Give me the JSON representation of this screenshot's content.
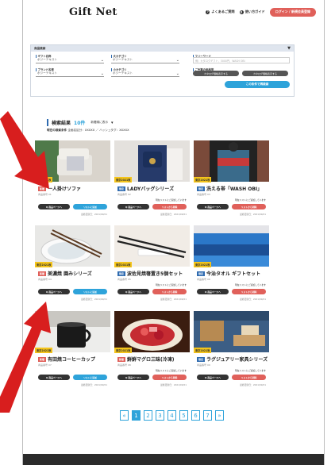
{
  "header": {
    "logo": "Gift Net",
    "faq": "よくあるご質問",
    "guide": "使い方ガイド",
    "login": "ログイン / 新規会員登録"
  },
  "search": {
    "panel_title": "商品検索",
    "giftname_label": "ギフト名称",
    "giftname_value": "ポジーテキスト",
    "maincat_label": "大カテゴリ",
    "maincat_value": "ポジーテキスト",
    "keyword_label": "フリーワード",
    "keyword_placeholder": "例）カタログギフト、3000円、WASH OBI",
    "brand_label": "ブランド名称",
    "brand_value": "ポジーテキスト",
    "subcat_label": "小カテゴリ",
    "subcat_value": "ポジーテキスト",
    "price_label": "ご予算の価格帯",
    "price_min_btn": "カタログ価格表示する",
    "price_max_btn": "カタログ価格表示する",
    "search_btn": "この条件で再検索"
  },
  "results": {
    "title": "検索結果",
    "count": "10件",
    "sort": "新着順に表示",
    "sub_label": "現在の検索条件",
    "sub_value": "企画名区分：XXXXX ／ ハッシュタグ：XXXXX"
  },
  "cards": [
    {
      "badge": "東京2021秋",
      "tag": "新着",
      "tag_color": "#e0605a",
      "title": "一人掛けソファ",
      "meta": "商品番号 01",
      "note": "",
      "btn1": "Q 商品ページへ",
      "btn2": "リストに追加",
      "btn2_color": "blue",
      "date": "最終更新日：2021/09/21"
    },
    {
      "badge": "東京2021秋",
      "tag": "限定",
      "tag_color": "#2f6bb0",
      "title": "LADYバッグシリーズ",
      "meta": "商品番号 02",
      "note": "現在リストにご追加しています",
      "btn1": "Q 商品ページへ",
      "btn2": "リストから削除",
      "btn2_color": "red",
      "date": "最終更新日：2021/09/21"
    },
    {
      "badge": "東京2021秋",
      "tag": "限定",
      "tag_color": "#2f6bb0",
      "title": "洗える帯「WASH OBI」",
      "meta": "商品番号 03",
      "note": "現在リストにご追加しています",
      "btn1": "Q 商品ページへ",
      "btn2": "リストから削除",
      "btn2_color": "red",
      "date": "最終更新日：2021/09/21"
    },
    {
      "badge": "東京2021秋",
      "tag": "新着",
      "tag_color": "#e0605a",
      "title": "美濃焼 園みシリーズ",
      "meta": "商品番号 04",
      "note": "",
      "btn1": "Q 商品ページへ",
      "btn2": "リストに追加",
      "btn2_color": "blue",
      "date": "最終更新日：2021/09/21"
    },
    {
      "badge": "東京2021秋",
      "tag": "限定",
      "tag_color": "#2f6bb0",
      "title": "波佐見焼箸置き5個セット",
      "meta": "商品番号 05",
      "note": "現在リストにご追加しています",
      "btn1": "Q 商品ページへ",
      "btn2": "リストから削除",
      "btn2_color": "red",
      "date": "最終更新日：2021/09/21"
    },
    {
      "badge": "東京2021秋",
      "tag": "限定",
      "tag_color": "#2f6bb0",
      "title": "今治タオル ギフトセット",
      "meta": "商品番号 06",
      "note": "現在リストにご追加しています",
      "btn1": "Q 商品ページへ",
      "btn2": "リストから削除",
      "btn2_color": "red",
      "date": "最終更新日：2021/09/21"
    },
    {
      "badge": "東京2021秋",
      "tag": "新着",
      "tag_color": "#e0605a",
      "title": "有田焼コーヒーカップ",
      "meta": "商品番号 07",
      "note": "",
      "btn1": "Q 商品ページへ",
      "btn2": "リストに追加",
      "btn2_color": "blue",
      "date": "最終更新日：2021/09/21"
    },
    {
      "badge": "東京2021秋",
      "tag": "新着",
      "tag_color": "#e0605a",
      "title": "鮮鮮マグロ三昧(冷凍)",
      "meta": "商品番号 08",
      "note": "現在リストにご追加しています",
      "btn1": "Q 商品ページへ",
      "btn2": "リストから削除",
      "btn2_color": "red",
      "date": "最終更新日：2021/09/21"
    },
    {
      "badge": "東京2021秋",
      "tag": "限定",
      "tag_color": "#2f6bb0",
      "title": "ラグジュアリー家具シリーズ",
      "meta": "商品番号 09",
      "note": "現在リストにご追加しています",
      "btn1": "Q 商品ページへ",
      "btn2": "リストから削除",
      "btn2_color": "red",
      "date": "最終更新日：2021/09/21"
    }
  ],
  "pagination": {
    "prev": "«",
    "pages": [
      "1",
      "2",
      "3",
      "4",
      "5",
      "6",
      "7"
    ],
    "next": "»",
    "active": "1"
  },
  "colors": {
    "accent_blue": "#2ea3da",
    "accent_red": "#e0605a",
    "badge_yellow": "#f5c51b",
    "arrow_red": "#d81e1e"
  }
}
